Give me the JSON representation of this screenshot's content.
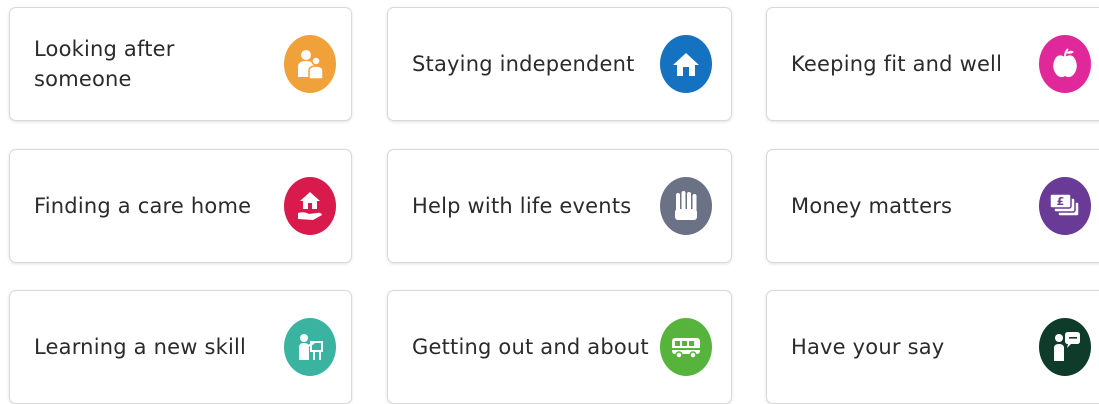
{
  "tiles": [
    {
      "label": "Looking after someone",
      "icon": "people-icon",
      "color": "#f0a13a"
    },
    {
      "label": "Staying independent",
      "icon": "house-icon",
      "color": "#1572c0"
    },
    {
      "label": "Keeping fit and well",
      "icon": "apple-icon",
      "color": "#e0289b"
    },
    {
      "label": "Finding a care home",
      "icon": "house-in-hand-icon",
      "color": "#d81b4c"
    },
    {
      "label": "Help with life events",
      "icon": "raised-hands-icon",
      "color": "#6b7285"
    },
    {
      "label": "Money matters",
      "icon": "pound-notes-icon",
      "color": "#6a3a97"
    },
    {
      "label": "Learning a new skill",
      "icon": "teacher-icon",
      "color": "#3bb3a1"
    },
    {
      "label": "Getting out and about",
      "icon": "bus-icon",
      "color": "#56b43c"
    },
    {
      "label": "Have your say",
      "icon": "person-speech-icon",
      "color": "#0f3b2a"
    }
  ]
}
